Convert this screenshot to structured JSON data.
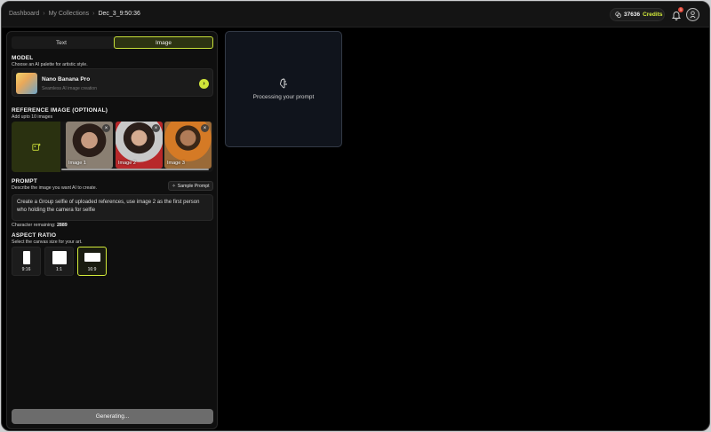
{
  "breadcrumb": {
    "items": [
      "Dashboard",
      "My Collections"
    ],
    "current": "Dec_3_9:50:36"
  },
  "header": {
    "credits_value": "37636",
    "credits_label": "Credits",
    "notification_count": "1"
  },
  "tabs": [
    {
      "label": "Text",
      "active": false
    },
    {
      "label": "Image",
      "active": true
    }
  ],
  "model": {
    "title": "MODEL",
    "subtitle": "Choose an AI palette for artistic style.",
    "name": "Nano Banana Pro",
    "description": "Seamless AI image creation"
  },
  "reference": {
    "title": "REFERENCE IMAGE (OPTIONAL)",
    "subtitle": "Add upto 10 images",
    "images": [
      {
        "label": "Image 1"
      },
      {
        "label": "Image 2"
      },
      {
        "label": "Image 3"
      }
    ]
  },
  "prompt": {
    "title": "PROMPT",
    "subtitle": "Describe the image you want AI to create.",
    "sample_label": "Sample Prompt",
    "text": "Create a Group selfie of uploaded references, use image 2 as the first person who holding the camera for selfie",
    "char_label": "Character remaining:",
    "char_value": "2889"
  },
  "aspect": {
    "title": "ASPECT RATIO",
    "subtitle": "Select the canvas size for your art.",
    "options": [
      {
        "label": "9:16"
      },
      {
        "label": "1:1"
      },
      {
        "label": "16:9"
      }
    ],
    "selected": "16:9"
  },
  "generate": {
    "label": "Generating..."
  },
  "processing": {
    "text": "Processing your prompt"
  },
  "colors": {
    "accent": "#d4ec3a",
    "background": "#000000",
    "panel": "#0f0f0f"
  }
}
